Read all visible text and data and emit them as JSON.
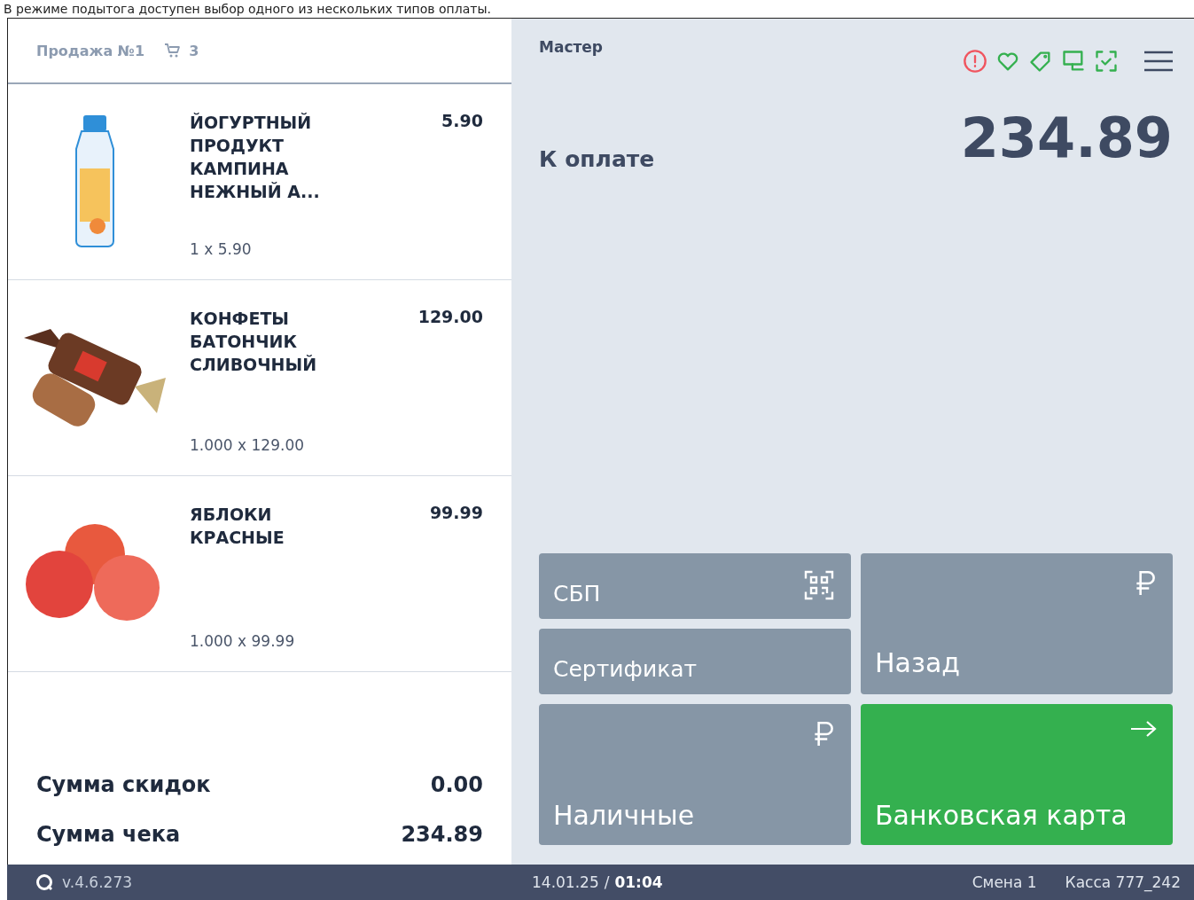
{
  "caption": "В режиме подытога доступен выбор одного из нескольких типов оплаты.",
  "sale": {
    "title": "Продажа №1",
    "cart_count": "3"
  },
  "items": [
    {
      "kind": "yogurt",
      "name": "ЙОГУРТНЫЙ ПРОДУКТ КАМПИНА НЕЖНЫЙ А...",
      "price": "5.90",
      "qty": "1 x 5.90"
    },
    {
      "kind": "candy",
      "name": "КОНФЕТЫ БАТОНЧИК СЛИВОЧНЫЙ",
      "price": "129.00",
      "qty": "1.000 x 129.00"
    },
    {
      "kind": "apples",
      "name": "ЯБЛОКИ КРАСНЫЕ",
      "price": "99.99",
      "qty": "1.000 x 99.99"
    }
  ],
  "totals": [
    {
      "label": "Сумма скидок",
      "value": "0.00"
    },
    {
      "label": "Сумма чека",
      "value": "234.89"
    }
  ],
  "master": "Мастер",
  "status_icons": [
    {
      "kind": "alert",
      "color": "#f0555f"
    },
    {
      "kind": "heart",
      "color": "#34b04f"
    },
    {
      "kind": "tag",
      "color": "#34b04f"
    },
    {
      "kind": "monitor",
      "color": "#34b04f"
    },
    {
      "kind": "scan",
      "color": "#34b04f"
    }
  ],
  "due": {
    "label": "К оплате",
    "amount": "234.89"
  },
  "payments": [
    {
      "label": "СБП",
      "kind": "sbp"
    },
    {
      "label": "Сертификат",
      "kind": "certificate"
    },
    {
      "label": "Наличные",
      "kind": "cash"
    },
    {
      "label": "Назад",
      "kind": "back"
    },
    {
      "label": "Банковская карта",
      "kind": "card"
    }
  ],
  "status_bar": {
    "version": "v.4.6.273",
    "date": "14.01.25",
    "separator": "/",
    "time": "01:04",
    "shift": "Смена 1",
    "register": "Касса 777_242"
  }
}
